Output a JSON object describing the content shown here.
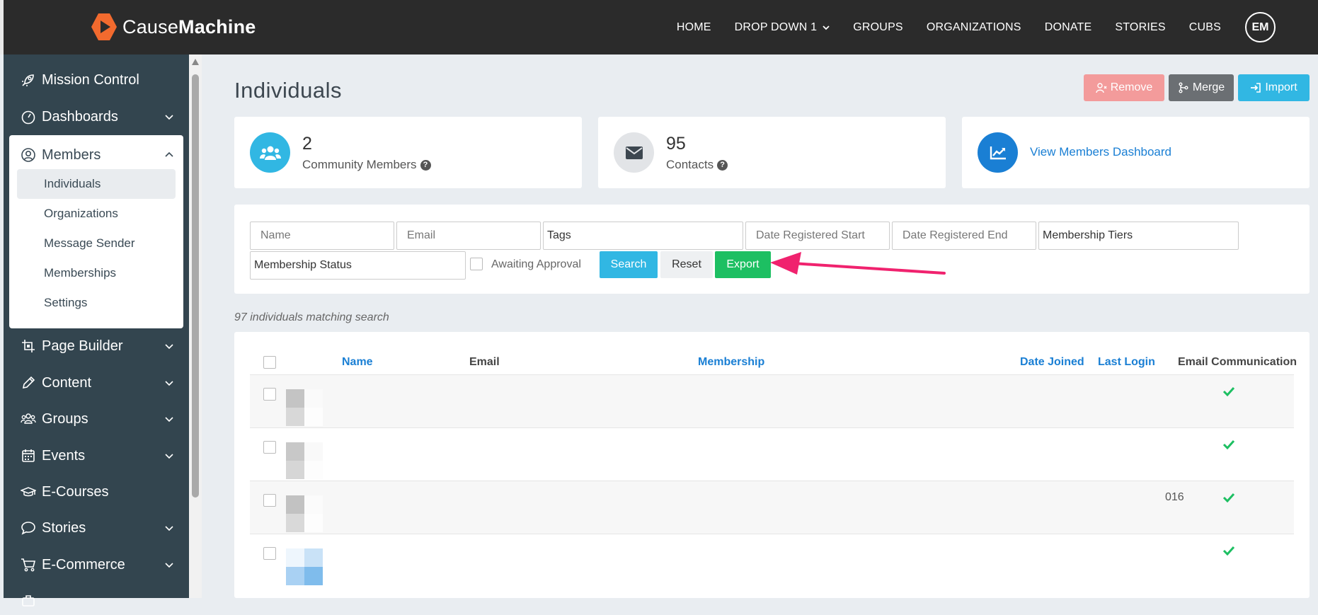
{
  "brand": {
    "name_part1": "Cause",
    "name_part2": "Machine",
    "accent": "#f26a2e"
  },
  "nav": {
    "items": [
      "HOME",
      "DROP DOWN 1",
      "GROUPS",
      "ORGANIZATIONS",
      "DONATE",
      "STORIES",
      "CUBS"
    ],
    "avatar_initials": "EM"
  },
  "sidebar": {
    "mission_control": "Mission Control",
    "dashboards": "Dashboards",
    "members": "Members",
    "members_sub": [
      "Individuals",
      "Organizations",
      "Message Sender",
      "Memberships",
      "Settings"
    ],
    "page_builder": "Page Builder",
    "content": "Content",
    "groups": "Groups",
    "events": "Events",
    "ecourses": "E-Courses",
    "stories": "Stories",
    "ecommerce": "E-Commerce"
  },
  "page": {
    "title": "Individuals",
    "remove_label": "Remove",
    "merge_label": "Merge",
    "import_label": "Import"
  },
  "stats": {
    "community_count": "2",
    "community_label": "Community Members",
    "contacts_count": "95",
    "contacts_label": "Contacts",
    "dashboard_link": "View Members Dashboard"
  },
  "filters": {
    "name_ph": "Name",
    "email_ph": "Email",
    "tags": "Tags",
    "date_start_ph": "Date Registered Start",
    "date_end_ph": "Date Registered End",
    "tiers": "Membership Tiers",
    "status": "Membership Status",
    "awaiting": "Awaiting Approval",
    "search": "Search",
    "reset": "Reset",
    "export": "Export"
  },
  "results": {
    "matching": "97 individuals matching search"
  },
  "table": {
    "headers": {
      "name": "Name",
      "email": "Email",
      "membership": "Membership",
      "date_joined": "Date Joined",
      "last_login": "Last Login",
      "email_comm": "Email Communication"
    },
    "row3_date_fragment": "016"
  },
  "colors": {
    "annotation_arrow": "#f0226e",
    "export_green": "#1dbf62",
    "search_blue": "#31b7e3",
    "check_green": "#1dbf62"
  }
}
